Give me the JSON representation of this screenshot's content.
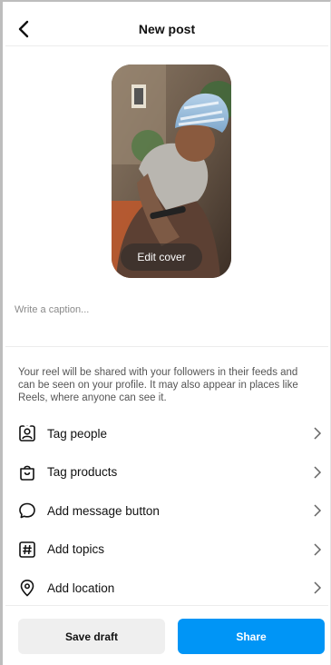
{
  "header": {
    "title": "New post"
  },
  "cover": {
    "edit_label": "Edit cover"
  },
  "caption": {
    "placeholder": "Write a caption..."
  },
  "info": {
    "text": "Your reel will be shared with your followers in their feeds and can be seen on your profile. It may also appear in places like Reels, where anyone can see it."
  },
  "menu": {
    "items": [
      {
        "label": "Tag people",
        "icon": "tag-people-icon"
      },
      {
        "label": "Tag products",
        "icon": "shopping-bag-icon"
      },
      {
        "label": "Add message button",
        "icon": "message-bubble-icon"
      },
      {
        "label": "Add topics",
        "icon": "hashtag-icon"
      },
      {
        "label": "Add location",
        "icon": "location-pin-icon"
      }
    ]
  },
  "footer": {
    "save_label": "Save draft",
    "share_label": "Share"
  },
  "colors": {
    "accent": "#0095f6",
    "secondary_button": "#efefef"
  }
}
